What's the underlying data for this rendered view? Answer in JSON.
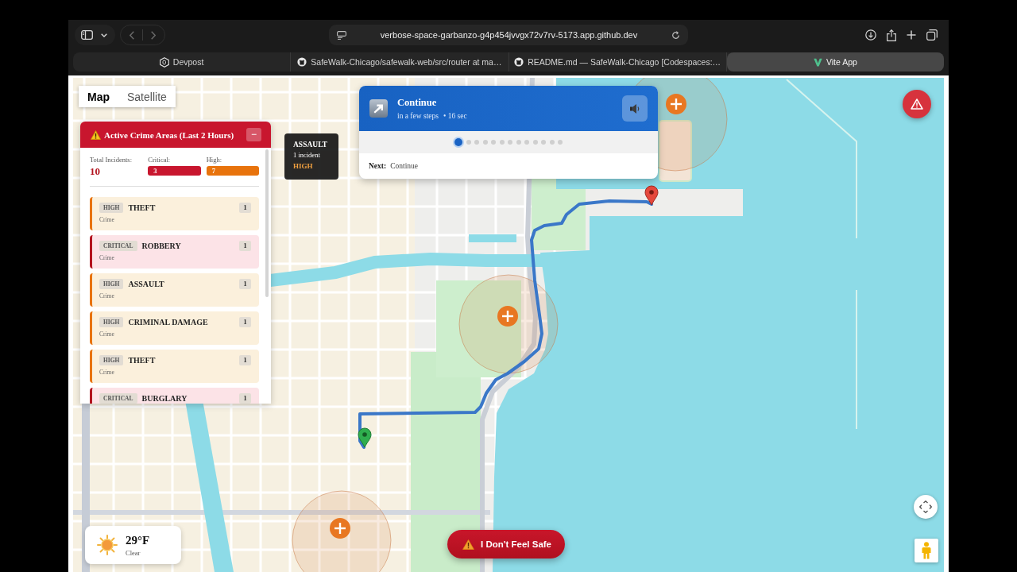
{
  "browser": {
    "url": "verbose-space-garbanzo-g4p454jvvgx72v7rv-5173.app.github.dev",
    "tabs": [
      {
        "title": "Devpost",
        "kind": "devpost",
        "selected": false
      },
      {
        "title": "SafeWalk-Chicago/safewalk-web/src/router at ma…",
        "kind": "github",
        "selected": false
      },
      {
        "title": "README.md — SafeWalk-Chicago [Codespaces:…",
        "kind": "github",
        "selected": false
      },
      {
        "title": "Vite App",
        "kind": "vite",
        "selected": true
      }
    ]
  },
  "map_type": [
    {
      "label": "Map",
      "selected": true
    },
    {
      "label": "Satellite",
      "selected": false
    }
  ],
  "crime_panel": {
    "title": "Active Crime Areas (Last 2 Hours)",
    "collapse_button": "−",
    "stats": [
      {
        "label": "Total Incidents:",
        "value": "10",
        "kind": "total"
      },
      {
        "label": "Critical:",
        "value": "3",
        "kind": "critical"
      },
      {
        "label": "High:",
        "value": "7",
        "kind": "high"
      }
    ],
    "areas": [
      {
        "severity": "HIGH",
        "kind": "high",
        "name": "THEFT",
        "count": "1",
        "category": "Crime"
      },
      {
        "severity": "CRITICAL",
        "kind": "critical",
        "name": "ROBBERY",
        "count": "1",
        "category": "Crime"
      },
      {
        "severity": "HIGH",
        "kind": "high",
        "name": "ASSAULT",
        "count": "1",
        "category": "Crime"
      },
      {
        "severity": "HIGH",
        "kind": "high",
        "name": "CRIMINAL DAMAGE",
        "count": "1",
        "category": "Crime"
      },
      {
        "severity": "HIGH",
        "kind": "high",
        "name": "THEFT",
        "count": "1",
        "category": "Crime"
      },
      {
        "severity": "CRITICAL",
        "kind": "critical",
        "name": "BURGLARY",
        "count": "1"
      }
    ]
  },
  "map_tooltip": {
    "title": "ASSAULT",
    "detail": "1 incident",
    "severity": "HIGH",
    "kind": "high"
  },
  "navigation": {
    "instruction": "Continue",
    "distance": "in a few steps",
    "duration": "• 16 sec",
    "steps": [
      {
        "selected": true
      },
      {
        "selected": false
      },
      {
        "selected": false
      },
      {
        "selected": false
      },
      {
        "selected": false
      },
      {
        "selected": false
      },
      {
        "selected": false
      },
      {
        "selected": false
      },
      {
        "selected": false
      },
      {
        "selected": false
      },
      {
        "selected": false
      },
      {
        "selected": false
      },
      {
        "selected": false
      }
    ],
    "next_label": "Next:",
    "next_instruction": "Continue"
  },
  "weather": {
    "temperature": "29°F",
    "condition": "Clear"
  },
  "safety_button": {
    "label": "I Don't Feel Safe"
  }
}
